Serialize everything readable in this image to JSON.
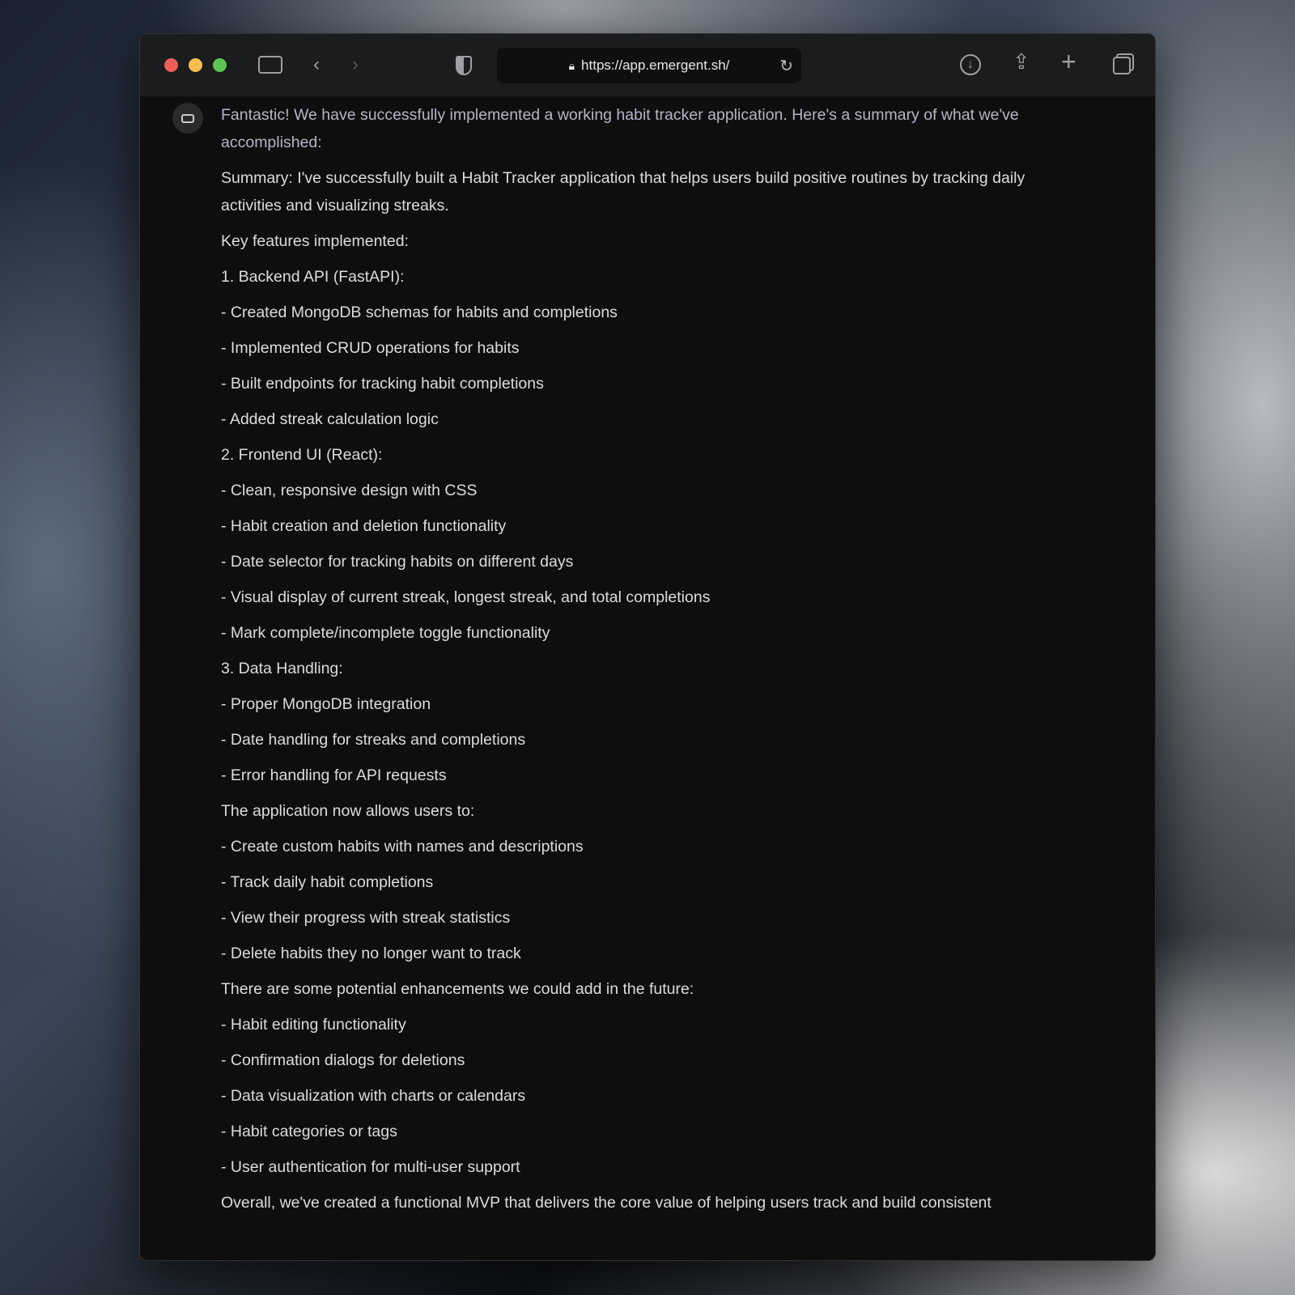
{
  "browser": {
    "url": "https://app.emergent.sh/"
  },
  "message": {
    "intro": "Fantastic! We have successfully implemented a working habit tracker application. Here's a summary of what we've accomplished:",
    "lines": [
      "Summary: I've successfully built a Habit Tracker application that helps users build positive routines by tracking daily activities and visualizing streaks.",
      "Key features implemented:",
      "1. Backend API (FastAPI):",
      "- Created MongoDB schemas for habits and completions",
      "- Implemented CRUD operations for habits",
      "- Built endpoints for tracking habit completions",
      "- Added streak calculation logic",
      "2. Frontend UI (React):",
      "- Clean, responsive design with CSS",
      "- Habit creation and deletion functionality",
      "- Date selector for tracking habits on different days",
      "- Visual display of current streak, longest streak, and total completions",
      "- Mark complete/incomplete toggle functionality",
      "3. Data Handling:",
      "- Proper MongoDB integration",
      "- Date handling for streaks and completions",
      "- Error handling for API requests",
      "The application now allows users to:",
      "- Create custom habits with names and descriptions",
      "- Track daily habit completions",
      "- View their progress with streak statistics",
      "- Delete habits they no longer want to track",
      "There are some potential enhancements we could add in the future:",
      "- Habit editing functionality",
      "- Confirmation dialogs for deletions",
      "- Data visualization with charts or calendars",
      "- Habit categories or tags",
      "- User authentication for multi-user support",
      "Overall, we've created a functional MVP that delivers the core value of helping users track and build consistent"
    ]
  }
}
